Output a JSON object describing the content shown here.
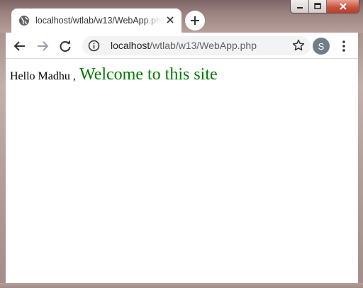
{
  "window": {
    "minimize_glyph": "–",
    "maximize_glyph": "□",
    "close_glyph": "✕"
  },
  "tab": {
    "title": "localhost/wtlab/w13/WebApp.php",
    "icon": "globe-icon",
    "close_glyph": "✕"
  },
  "toolbar": {
    "url_host": "localhost",
    "url_path": "/wtlab/w13/WebApp.php",
    "profile_initial": "S",
    "profile_color": "#6f7e8a"
  },
  "page": {
    "greeting": "Hello Madhu ,",
    "welcome": "Welcome to this site",
    "welcome_color": "#007a00"
  }
}
